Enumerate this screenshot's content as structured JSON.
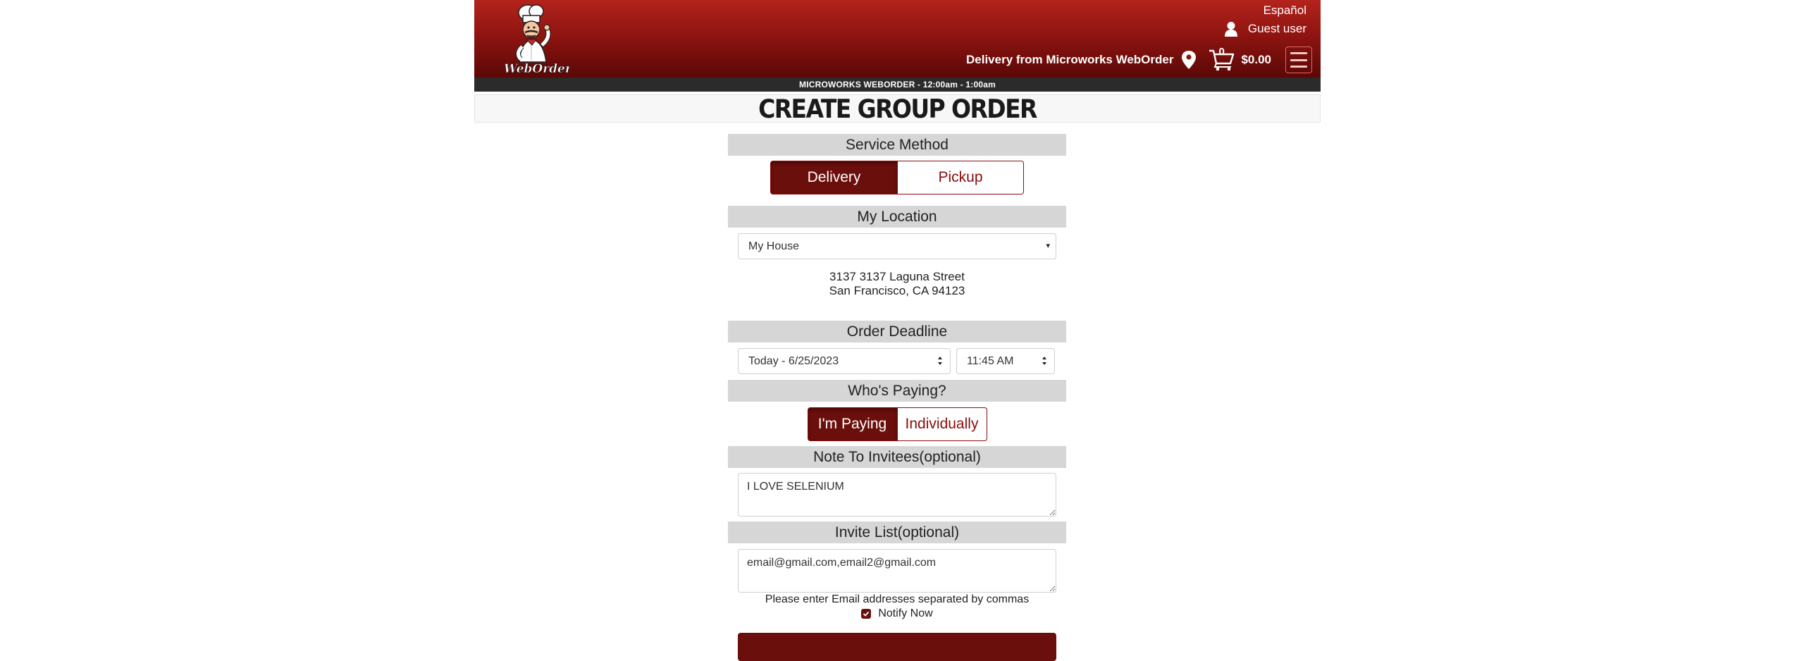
{
  "header": {
    "logo_text": "WebOrder",
    "language_link": "Español",
    "user_label": "Guest user",
    "delivery_from": "Delivery from Microworks WebOrder",
    "cart_count": "0",
    "cart_total": "$0.00",
    "hours": "MICROWORKS WEBORDER - 12:00am - 1:00am"
  },
  "page": {
    "title": "CREATE GROUP ORDER"
  },
  "service_method": {
    "heading": "Service Method",
    "options": [
      "Delivery",
      "Pickup"
    ],
    "selected": "Delivery"
  },
  "location": {
    "heading": "My Location",
    "selected": "My House",
    "address_line1": "3137 3137 Laguna Street",
    "address_line2": "San Francisco, CA 94123"
  },
  "deadline": {
    "heading": "Order Deadline",
    "date": "Today - 6/25/2023",
    "time": "11:45 AM"
  },
  "paying": {
    "heading": "Who's Paying?",
    "options": [
      "I'm Paying",
      "Individually"
    ],
    "selected": "I'm Paying"
  },
  "note": {
    "heading": "Note To Invitees(optional)",
    "value": "I LOVE SELENIUM"
  },
  "invite": {
    "heading": "Invite List(optional)",
    "value": "email@gmail.com,email2@gmail.com",
    "help": "Please enter Email addresses separated by commas",
    "notify_label": "Notify Now",
    "notify_checked": true
  },
  "colors": {
    "brand": "#8f1411",
    "button_active": "#6b0f0c",
    "section_bar": "#d6d6d6"
  },
  "icons": {
    "user": "user-icon",
    "location": "map-pin-icon",
    "cart": "cart-icon",
    "menu": "hamburger-icon"
  }
}
